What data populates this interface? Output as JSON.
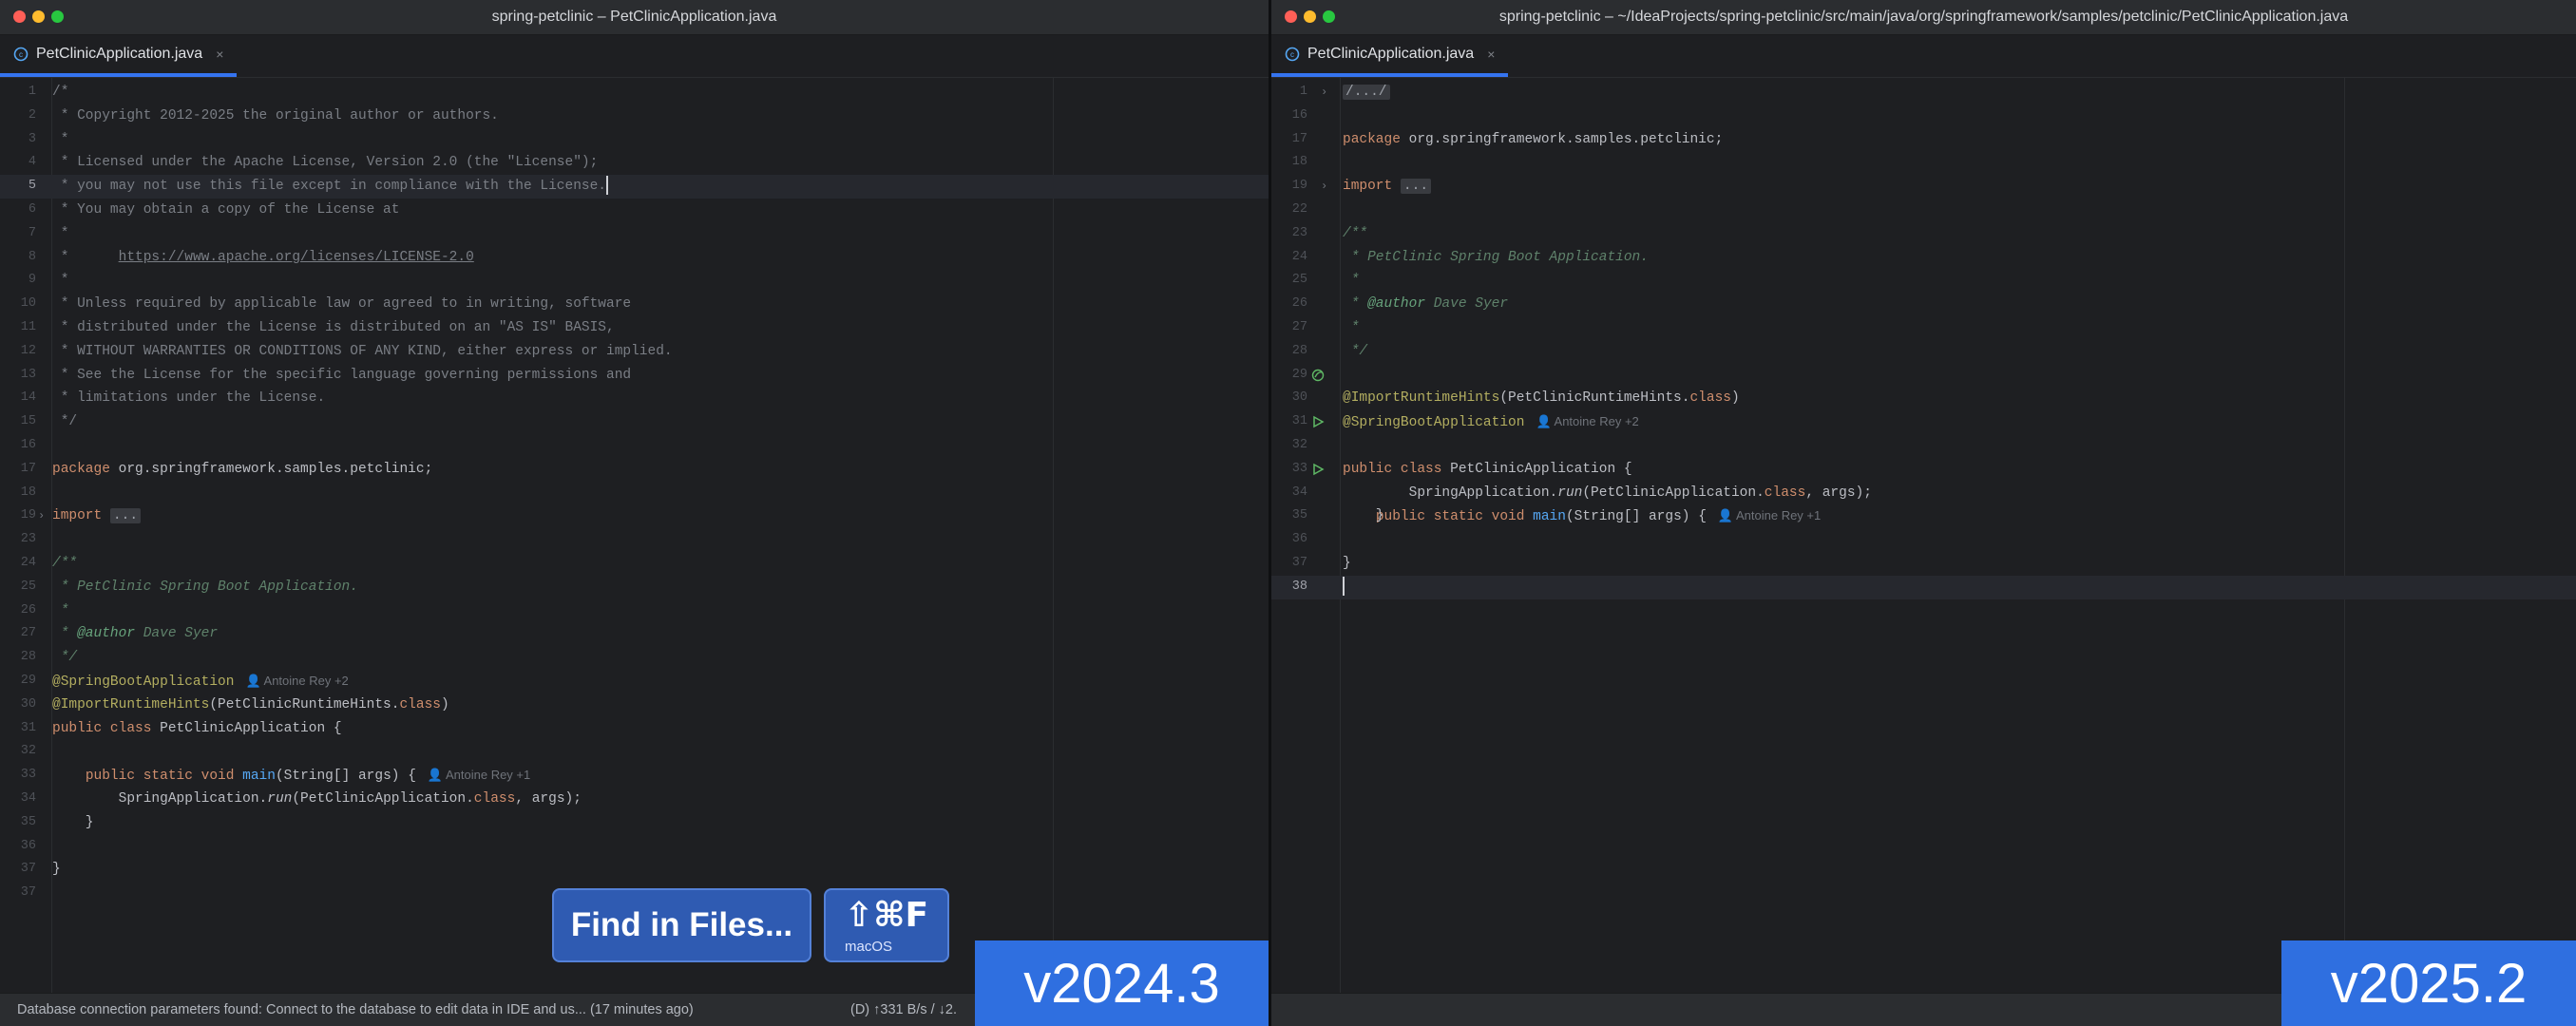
{
  "left": {
    "title": "spring-petclinic – PetClinicApplication.java",
    "tab_label": "PetClinicApplication.java",
    "tab_close": "×",
    "status_message": "Database connection parameters found: Connect to the database to edit data in IDE and us... (17 minutes ago)",
    "status_network": "(D) ↑331 B/s / ↓2.",
    "version_badge": "v2024.3",
    "lines": {
      "l1": "/*",
      "l2": " * Copyright 2012-2025 the original author or authors.",
      "l3": " *",
      "l4": " * Licensed under the Apache License, Version 2.0 (the \"License\");",
      "l5": " * you may not use this file except in compliance with the License.",
      "l6": " * You may obtain a copy of the License at",
      "l7": " *",
      "l8_pre": " *      ",
      "l8_link": "https://www.apache.org/licenses/LICENSE-2.0",
      "l9": " *",
      "l10": " * Unless required by applicable law or agreed to in writing, software",
      "l11": " * distributed under the License is distributed on an \"AS IS\" BASIS,",
      "l12": " * WITHOUT WARRANTIES OR CONDITIONS OF ANY KIND, either express or implied.",
      "l13": " * See the License for the specific language governing permissions and",
      "l14": " * limitations under the License.",
      "l15": " */",
      "l17_kw": "package",
      "l17_rest": " org.springframework.samples.petclinic;",
      "l19_kw": "import",
      "l19_folded": "...",
      "l23": "/**",
      "l24": " * PetClinic Spring Boot Application.",
      "l25": " *",
      "l26_pre": " * ",
      "l26_tag": "@author",
      "l26_rest": " Dave Syer",
      "l27": " */",
      "l28_ann": "@SpringBootApplication",
      "l28_author": "👤 Antoine Rey +2",
      "l29_ann": "@ImportRuntimeHints",
      "l29_a": "(PetClinicRuntimeHints.",
      "l29_kw": "class",
      "l29_b": ")",
      "l30_kw": "public class",
      "l30_rest": " PetClinicApplication {",
      "l32_indent": "    ",
      "l32_kw": "public static void",
      "l32_sp": " ",
      "l32_fn": "main",
      "l32_rest": "(String[] args) {",
      "l32_author": "👤 Antoine Rey +1",
      "l33_a": "        SpringApplication.",
      "l33_run": "run",
      "l33_b": "(PetClinicApplication.",
      "l33_kw": "class",
      "l33_c": ", args);",
      "l34": "    }",
      "l36": "}"
    },
    "line_numbers": [
      "1",
      "2",
      "3",
      "4",
      "5",
      "6",
      "7",
      "8",
      "9",
      "10",
      "11",
      "12",
      "13",
      "14",
      "15",
      "16",
      "17",
      "18",
      "19",
      "23",
      "24",
      "25",
      "26",
      "27",
      "28",
      "29",
      "30",
      "31",
      "32",
      "33",
      "34",
      "35",
      "36",
      "37"
    ]
  },
  "right": {
    "title": "spring-petclinic – ~/IdeaProjects/spring-petclinic/src/main/java/org/springframework/samples/petclinic/PetClinicApplication.java",
    "tab_label": "PetClinicApplication.java",
    "tab_close": "×",
    "version_badge": "v2025.2",
    "lines": {
      "l1_folded": "/.../",
      "l17_kw": "package",
      "l17_rest": " org.springframework.samples.petclinic;",
      "l19_kw": "import",
      "l19_folded": "...",
      "l23": "/**",
      "l24": " * PetClinic Spring Boot Application.",
      "l25": " *",
      "l26_pre": " * ",
      "l26_tag": "@author",
      "l26_rest": " Dave Syer",
      "l27": " *",
      "l28": " */",
      "l29_ann": "@SpringBootApplication",
      "l29_author": "👤 Antoine Rey +2",
      "l30_ann": "@ImportRuntimeHints",
      "l30_a": "(PetClinicRuntimeHints.",
      "l30_kw": "class",
      "l30_b": ")",
      "l31_kw": "public class",
      "l31_rest": " PetClinicApplication {",
      "l33_indent": "    ",
      "l33_kw": "public static void",
      "l33_sp": " ",
      "l33_fn": "main",
      "l33_rest": "(String[] args) {",
      "l33_author": "👤 Antoine Rey +1",
      "l34_a": "        SpringApplication.",
      "l34_run": "run",
      "l34_b": "(PetClinicApplication.",
      "l34_kw": "class",
      "l34_c": ", args);",
      "l35": "    }",
      "l37": "}"
    },
    "line_numbers": [
      "1",
      "16",
      "17",
      "18",
      "19",
      "22",
      "23",
      "24",
      "25",
      "26",
      "27",
      "28",
      "29",
      "30",
      "31",
      "32",
      "33",
      "34",
      "35",
      "36",
      "37",
      "38"
    ]
  },
  "overlay": {
    "find_label": "Find in Files...",
    "shortcut": "⇧⌘F",
    "shortcut_os": "macOS"
  },
  "icons": {
    "traffic_lights": [
      "close-light",
      "minimize-light",
      "zoom-light"
    ],
    "tab_file_icon": "java-class-icon",
    "run_gutter_icon": "run-triangle-icon",
    "spring_gutter_icon": "spring-bean-icon",
    "fold_icon": "chevron-right-icon",
    "author_icon": "person-icon"
  },
  "colors": {
    "accent": "#3574f0",
    "badge": "#2f6fe0",
    "editor_bg": "#1e1f22",
    "keyword": "#cf8e6d",
    "annotation": "#b3ae60",
    "function": "#56a8f5",
    "comment": "#7a7e85",
    "doc_comment": "#5f826b"
  }
}
